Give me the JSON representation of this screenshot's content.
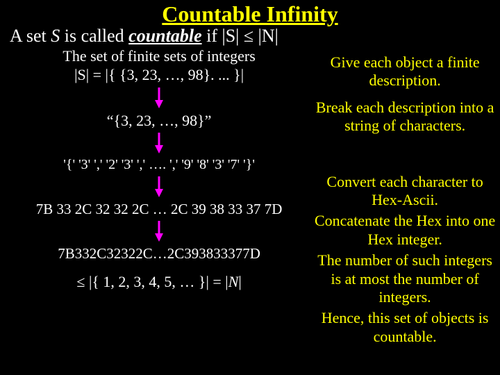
{
  "title": "Countable Infinity",
  "defn": {
    "prefix": "A set ",
    "S": "S",
    "mid": " is called ",
    "countable": "countable",
    "suffix": " if |S| ≤ |N|"
  },
  "left": {
    "l1": "The set of finite sets of integers",
    "l2": "|S| = |{  {3, 23, …, 98}. ...  }|",
    "l3": "“{3, 23, …, 98}”",
    "l4": "'{'  '3'  ','  '2'  '3'  ','  ….  ','  '9'  '8'  '3'  '7'  '}'",
    "l5": "7B 33 2C 32 32 2C … 2C 39 38 33 37 7D",
    "l6": "7B332C32322C…2C393833377D",
    "l7a": "≤ |{ 1,   2,   3,  4,  5, … }|  =  |",
    "l7N": "N",
    "l7b": "|"
  },
  "right": {
    "r1": "Give each object a finite description.",
    "r2": "Break each description into a string of characters.",
    "r3": "Convert each character to Hex-Ascii.",
    "r4": "Concatenate the Hex into one Hex integer.",
    "r5": "The number of such integers is at most the number of integers.",
    "r6": "Hence, this set of objects is countable."
  }
}
